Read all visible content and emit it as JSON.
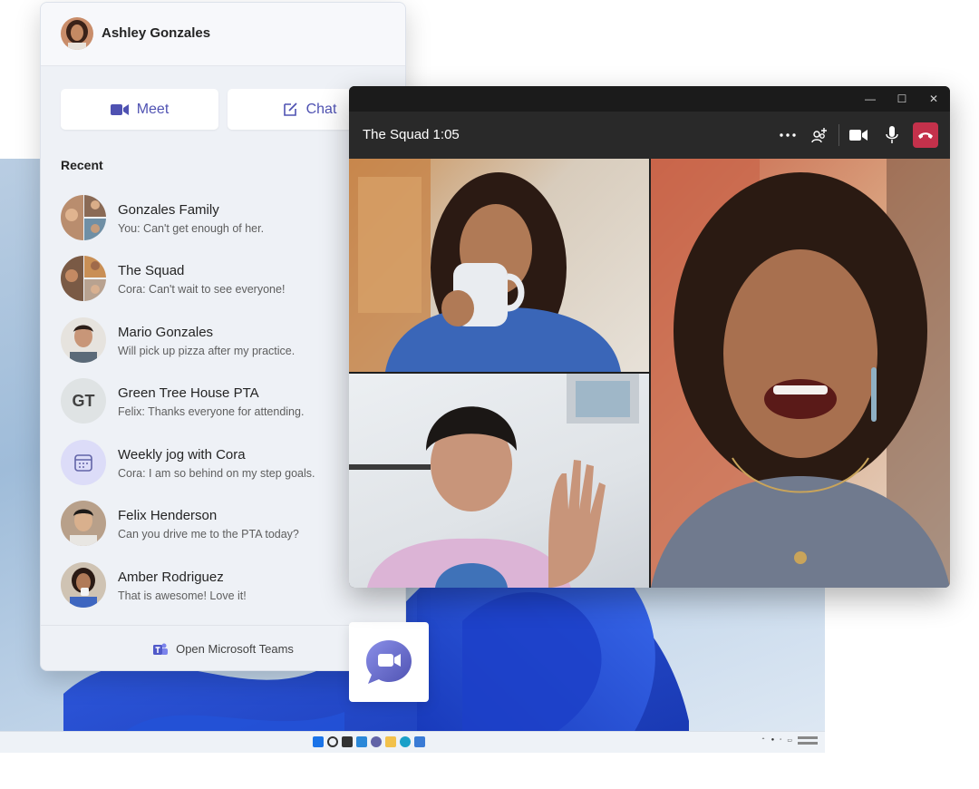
{
  "profile": {
    "name": "Ashley Gonzales"
  },
  "actions": {
    "meet_label": "Meet",
    "chat_label": "Chat"
  },
  "recent_label": "Recent",
  "chats": [
    {
      "title": "Gonzales Family",
      "preview": "You: Can't get enough of her."
    },
    {
      "title": "The Squad",
      "preview": "Cora: Can't wait to see everyone!"
    },
    {
      "title": "Mario Gonzales",
      "preview": "Will pick up pizza after my practice."
    },
    {
      "title": "Green Tree House PTA",
      "preview": "Felix: Thanks everyone for attending.",
      "initials": "GT"
    },
    {
      "title": "Weekly jog with Cora",
      "preview": "Cora: I am so behind on my step goals."
    },
    {
      "title": "Felix Henderson",
      "preview": "Can you drive me to the PTA today?"
    },
    {
      "title": "Amber Rodriguez",
      "preview": "That is awesome! Love it!"
    }
  ],
  "footer": {
    "open_teams_label": "Open Microsoft Teams"
  },
  "call": {
    "title": "The Squad 1:05",
    "controls": [
      "more-options-icon",
      "add-people-icon",
      "video-camera-icon",
      "microphone-icon",
      "hang-up-icon"
    ],
    "hangup_color": "#c4314b"
  },
  "window_controls": [
    "minimize",
    "maximize",
    "close"
  ],
  "colors": {
    "accent": "#4f52b2",
    "flyout_bg": "#eef1f6",
    "call_bg": "#292929"
  }
}
